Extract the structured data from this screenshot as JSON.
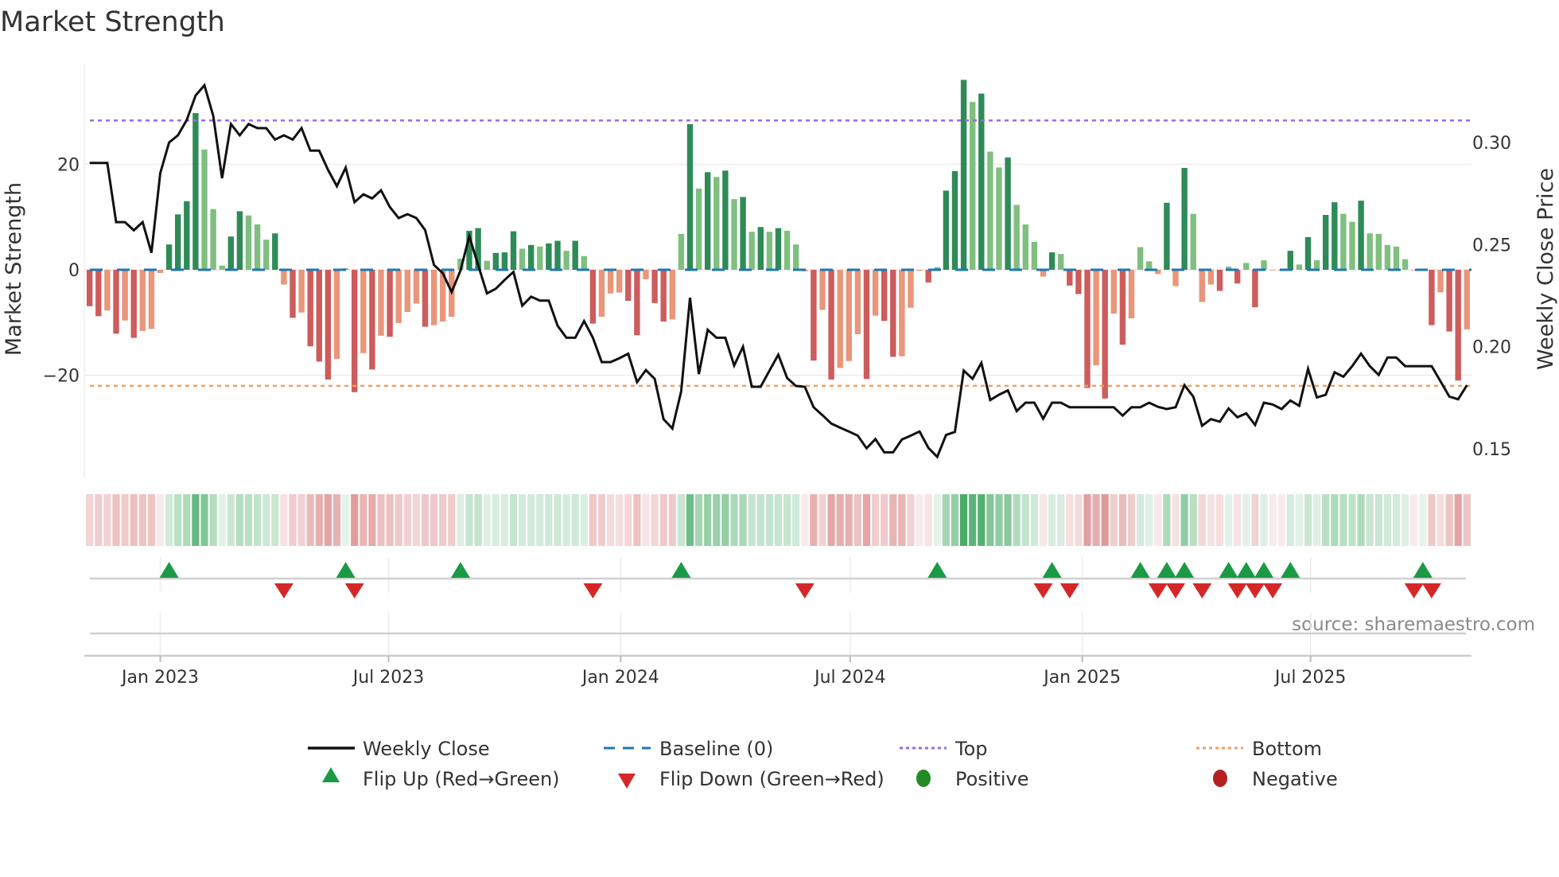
{
  "chart_data": {
    "type": "bar",
    "title": "Market Strength",
    "ylabel": "Market Strength",
    "y2label": "Weekly Close Price",
    "source": "source: sharemaestro.com",
    "x_start": "2022-11-06",
    "x_step_days": 7,
    "ylim": [
      -38,
      39
    ],
    "y2lim": [
      0.139,
      0.344
    ],
    "yticks": [
      {
        "value": 20,
        "label": "20"
      },
      {
        "value": 0,
        "label": "0"
      },
      {
        "value": -20,
        "label": "−20"
      }
    ],
    "y2ticks": [
      {
        "value": 0.3,
        "label": "0.30"
      },
      {
        "value": 0.25,
        "label": "0.25"
      },
      {
        "value": 0.2,
        "label": "0.20"
      },
      {
        "value": 0.15,
        "label": "0.15"
      }
    ],
    "xticks": [
      {
        "date": "2023-01-01",
        "label": "Jan 2023"
      },
      {
        "date": "2023-07-01",
        "label": "Jul 2023"
      },
      {
        "date": "2024-01-01",
        "label": "Jan 2024"
      },
      {
        "date": "2024-07-01",
        "label": "Jul 2024"
      },
      {
        "date": "2025-01-01",
        "label": "Jan 2025"
      },
      {
        "date": "2025-07-01",
        "label": "Jul 2025"
      }
    ],
    "top_level": 28.3,
    "bottom_level": -22.0,
    "baseline": 0,
    "grid": true,
    "strength": [
      -6.9,
      -8.8,
      -7.7,
      -12.1,
      -9.6,
      -12.9,
      -11.6,
      -11.2,
      -0.6,
      4.8,
      10.5,
      13.0,
      29.7,
      22.8,
      11.5,
      0.8,
      6.3,
      11.1,
      10.3,
      8.6,
      5.7,
      6.9,
      -2.8,
      -9.1,
      -8.1,
      -14.5,
      -17.4,
      -20.8,
      -16.9,
      0.3,
      -23.2,
      -15.8,
      -18.9,
      -12.5,
      -12.7,
      -10.1,
      -8.0,
      -6.4,
      -10.8,
      -10.5,
      -9.8,
      -8.9,
      2.1,
      7.4,
      7.9,
      1.7,
      3.2,
      3.3,
      7.3,
      4.0,
      4.7,
      4.4,
      5.0,
      5.5,
      3.6,
      5.5,
      2.6,
      -10.2,
      -8.9,
      -4.5,
      -4.3,
      -5.9,
      -12.4,
      -1.8,
      -6.3,
      -9.8,
      -9.4,
      6.8,
      27.6,
      15.4,
      18.5,
      17.6,
      18.8,
      13.4,
      13.8,
      7.2,
      8.1,
      7.2,
      7.9,
      7.4,
      4.8,
      -0.3,
      -17.2,
      -7.6,
      -20.8,
      -18.6,
      -17.3,
      -12.2,
      -20.7,
      -8.7,
      -9.7,
      -16.5,
      -16.4,
      -7.2,
      -0.2,
      -2.4,
      0.5,
      15.0,
      18.7,
      36.0,
      31.8,
      33.4,
      22.4,
      19.4,
      21.3,
      12.3,
      8.6,
      5.3,
      -1.3,
      3.3,
      3.0,
      -3.0,
      -4.6,
      -22.4,
      -18.1,
      -24.4,
      -8.3,
      -14.2,
      -9.2,
      4.3,
      1.6,
      -0.8,
      12.7,
      -3.1,
      19.3,
      10.6,
      -6.1,
      -2.8,
      -4.0,
      0.6,
      -2.6,
      1.3,
      -7.1,
      1.8,
      -0.1,
      -0.1,
      3.6,
      1.0,
      6.2,
      1.8,
      10.4,
      12.8,
      10.6,
      9.1,
      13.1,
      6.9,
      6.8,
      4.7,
      4.4,
      2.0,
      -0.1,
      0.2,
      -10.5,
      -4.3,
      -11.7,
      -21.0,
      -11.3
    ],
    "weekly_close": [
      0.29,
      0.29,
      0.29,
      0.261,
      0.261,
      0.257,
      0.261,
      0.246,
      0.285,
      0.3,
      0.3035,
      0.311,
      0.323,
      0.328,
      0.313,
      0.2825,
      0.309,
      0.3035,
      0.309,
      0.307,
      0.307,
      0.3014,
      0.3035,
      0.3014,
      0.307,
      0.296,
      0.296,
      0.2866,
      0.2786,
      0.2877,
      0.2708,
      0.2746,
      0.2726,
      0.2766,
      0.2684,
      0.263,
      0.2649,
      0.263,
      0.2571,
      0.24,
      0.236,
      0.2268,
      0.2373,
      0.2541,
      0.24,
      0.2261,
      0.2284,
      0.2327,
      0.2366,
      0.2201,
      0.2245,
      0.2226,
      0.2226,
      0.2103,
      0.2044,
      0.2044,
      0.2126,
      0.2044,
      0.1925,
      0.1925,
      0.1944,
      0.1966,
      0.1827,
      0.1886,
      0.1843,
      0.1646,
      0.16,
      0.1782,
      0.224,
      0.1866,
      0.2083,
      0.2044,
      0.2044,
      0.1908,
      0.2,
      0.1804,
      0.1804,
      0.1883,
      0.1961,
      0.1847,
      0.1808,
      0.1804,
      0.1704,
      0.1665,
      0.1624,
      0.1604,
      0.1585,
      0.1565,
      0.1503,
      0.1548,
      0.1483,
      0.1483,
      0.1546,
      0.1565,
      0.1585,
      0.1505,
      0.1461,
      0.1568,
      0.1583,
      0.1883,
      0.1843,
      0.1921,
      0.1739,
      0.1765,
      0.1786,
      0.1685,
      0.1726,
      0.1726,
      0.1648,
      0.1726,
      0.1726,
      0.1704,
      0.1704,
      0.1704,
      0.1704,
      0.1704,
      0.1704,
      0.1663,
      0.1704,
      0.1704,
      0.1726,
      0.1706,
      0.1695,
      0.1704,
      0.1812,
      0.1756,
      0.1613,
      0.1646,
      0.1633,
      0.1698,
      0.1655,
      0.1674,
      0.1617,
      0.1726,
      0.1717,
      0.1695,
      0.1737,
      0.1711,
      0.1892,
      0.1752,
      0.1765,
      0.1875,
      0.1853,
      0.1905,
      0.1966,
      0.1905,
      0.1862,
      0.1947,
      0.1947,
      0.1905,
      0.1905,
      0.1905,
      0.1905,
      0.1831,
      0.1756,
      0.1743,
      0.1812
    ],
    "legend": {
      "placement": "bottom",
      "items": [
        {
          "label": "Weekly Close",
          "key": "close"
        },
        {
          "label": "Baseline (0)",
          "key": "baseline"
        },
        {
          "label": "Top",
          "key": "top"
        },
        {
          "label": "Bottom",
          "key": "bottom"
        },
        {
          "label": "Flip Up (Red→Green)",
          "key": "flip_up"
        },
        {
          "label": "Flip Down (Green→Red)",
          "key": "flip_down"
        },
        {
          "label": "Positive",
          "key": "positive"
        },
        {
          "label": "Negative",
          "key": "negative"
        }
      ]
    },
    "colors": {
      "pos_strong": "#2e8b57",
      "pos_weak": "#80bf80",
      "neg_strong": "#cd5c5c",
      "neg_weak": "#e9967a",
      "close": "#111111",
      "baseline": "#1f77b4",
      "top": "#9b6ae0",
      "bottom": "#f0a060",
      "flip_up": "#1a9a44",
      "flip_down": "#d62728",
      "positive": "#228b22",
      "negative": "#b22222"
    }
  }
}
